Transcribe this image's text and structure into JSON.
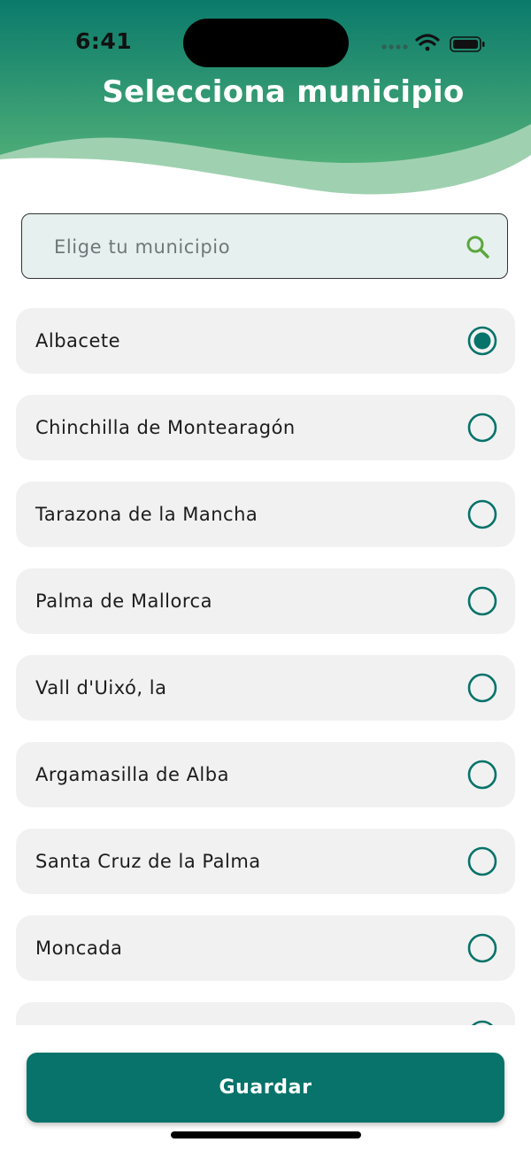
{
  "status_bar": {
    "time": "6:41"
  },
  "header": {
    "title": "Selecciona municipio"
  },
  "search": {
    "placeholder": "Elige tu municipio",
    "value": "",
    "icon": "search-icon"
  },
  "municipalities": {
    "selected": "Albacete",
    "items": [
      {
        "label": "Albacete",
        "selected": true
      },
      {
        "label": "Chinchilla de Montearagón",
        "selected": false
      },
      {
        "label": "Tarazona de la Mancha",
        "selected": false
      },
      {
        "label": "Palma de Mallorca",
        "selected": false
      },
      {
        "label": "Vall d'Uixó, la",
        "selected": false
      },
      {
        "label": "Argamasilla de Alba",
        "selected": false
      },
      {
        "label": "Santa Cruz de la Palma",
        "selected": false
      },
      {
        "label": "Moncada",
        "selected": false
      },
      {
        "label": "",
        "selected": false
      }
    ]
  },
  "footer": {
    "save_label": "Guardar"
  },
  "colors": {
    "primary": "#07736a",
    "header_gradient_dark": "#0a7a6b",
    "header_gradient_light": "#4fae78",
    "wave_light": "#9fd1b0",
    "search_background": "#e6f0ee",
    "search_icon": "#5aa63c",
    "item_background": "#f1f1f1"
  }
}
